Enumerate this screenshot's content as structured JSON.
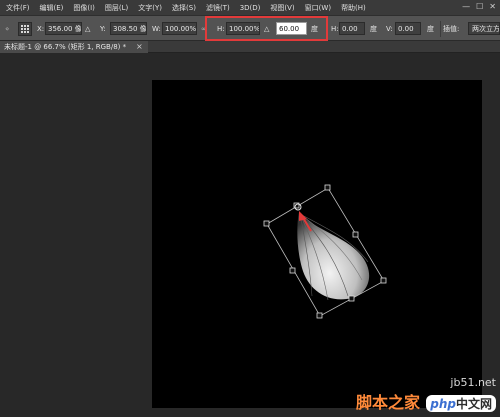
{
  "menu": [
    "文件(F)",
    "编辑(E)",
    "图像(I)",
    "图层(L)",
    "文字(Y)",
    "选择(S)",
    "滤镜(T)",
    "3D(D)",
    "视图(V)",
    "窗口(W)",
    "帮助(H)"
  ],
  "window_controls": [
    "—",
    "☐",
    "✕"
  ],
  "options": {
    "x_label": "X:",
    "x_value": "356.00 像",
    "y_label": "Y:",
    "y_value": "308.50 像",
    "w_label": "W:",
    "w_value": "100.00%",
    "h_label": "H:",
    "h_value": "100.00%",
    "angle_value": "60.00",
    "angle_unit": "度",
    "hskew_label": "H:",
    "hskew_value": "0.00",
    "hskew_unit": "度",
    "vskew_label": "V:",
    "vskew_value": "0.00",
    "vskew_unit": "度",
    "interp_label": "插值:",
    "interp_value": "两次立方"
  },
  "document_tab": "未标题-1 @ 66.7% (矩形 1, RGB/8) *",
  "watermark": {
    "site": "jb51.net",
    "title": "脚本之家",
    "php": "php",
    "cn": "中文网"
  },
  "colors": {
    "highlight": "#e23a3a",
    "arrow": "#e23a3a",
    "canvas": "#000000",
    "workspace": "#282828"
  }
}
